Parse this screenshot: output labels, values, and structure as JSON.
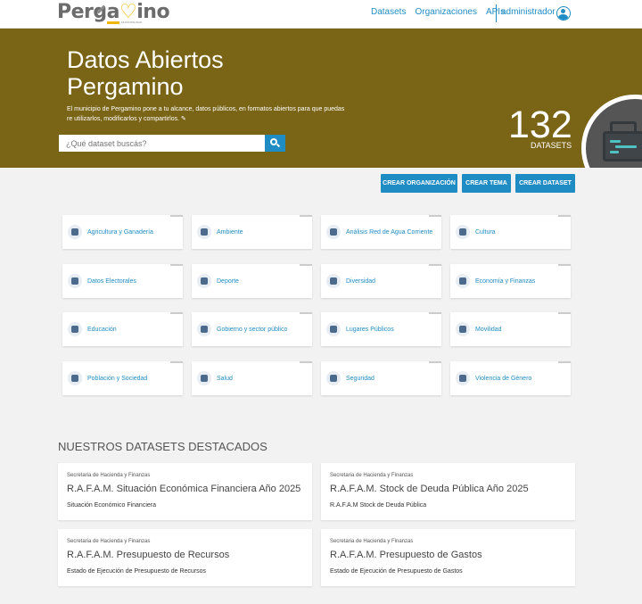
{
  "brand": {
    "logo_start": "Perga",
    "logo_heart": "♡",
    "logo_end": "ino",
    "logo_sub": "MUNICIPALIDAD"
  },
  "nav": {
    "datasets": "Datasets",
    "organizations": "Organizaciones",
    "apis": "APIs",
    "user": "administrador"
  },
  "hero": {
    "title": "Datos Abiertos Pergamino",
    "description": "El municipio de Pergamino pone a tu alcance, datos públicos, en formatos abiertos para que puedas re utilizarlos, modificarlos y compartirlos.",
    "search_placeholder": "¿Qué dataset buscás?",
    "count": "132",
    "count_label": "DATASETS"
  },
  "actions": {
    "create_org": "CREAR ORGANIZACIÓN",
    "create_topic": "CREAR TEMA",
    "create_dataset": "CREAR DATASET"
  },
  "topics": [
    "Agricultura y Ganadería",
    "Ambiente",
    "Análisis Red de Agua Corriente",
    "Cultura",
    "Datos Electorales",
    "Deporte",
    "Diversidad",
    "Economía y Finanzas",
    "Educación",
    "Gobierno y sector público",
    "Lugares Públicos",
    "Movilidad",
    "Población y Sociedad",
    "Salud",
    "Seguridad",
    "Violencia de Género"
  ],
  "featured": {
    "title": "NUESTROS DATASETS DESTACADOS",
    "items": [
      {
        "org": "Secretaria de Hacienda y Finanzas",
        "title": "R.A.F.A.M. Situación Económica Financiera Año 2025",
        "subtitle": "Situación Económico Financiera"
      },
      {
        "org": "Secretaria de Hacienda y Finanzas",
        "title": "R.A.F.A.M. Stock de Deuda Pública Año 2025",
        "subtitle": "R.A.F.A.M Stock de Deuda Pública"
      },
      {
        "org": "Secretaria de Hacienda y Finanzas",
        "title": "R.A.F.A.M. Presupuesto de Recursos",
        "subtitle": "Estado de Ejecución de Presupuesto de Recursos"
      },
      {
        "org": "Secretaria de Hacienda y Finanzas",
        "title": "R.A.F.A.M. Presupuesto de Gastos",
        "subtitle": "Estado de Ejecución de Presupuesto de Gastos"
      }
    ]
  },
  "colors": {
    "accent": "#1f8cc4",
    "hero_bg": "#7a6416",
    "brand_yellow": "#f2b705"
  }
}
